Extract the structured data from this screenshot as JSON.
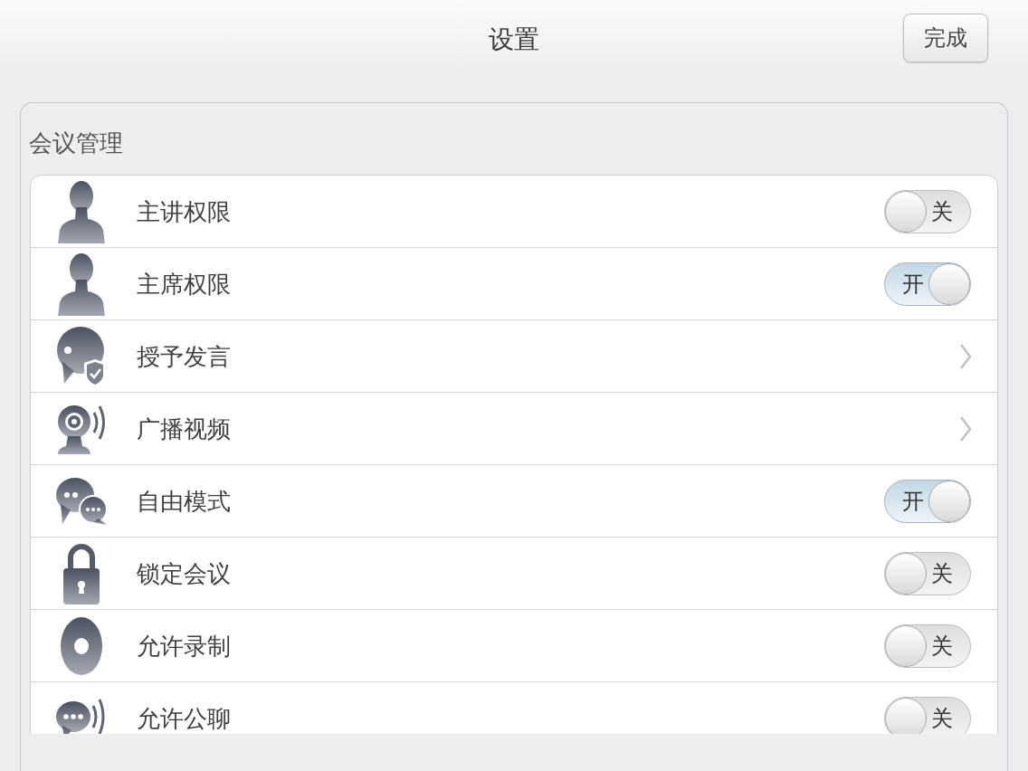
{
  "header": {
    "title": "设置",
    "done_button": "完成"
  },
  "section": {
    "title": "会议管理",
    "rows": [
      {
        "kind": "toggle",
        "label": "主讲权限",
        "on": false,
        "switch_text": "关"
      },
      {
        "kind": "toggle",
        "label": "主席权限",
        "on": true,
        "switch_text": "开"
      },
      {
        "kind": "link",
        "label": "授予发言"
      },
      {
        "kind": "link",
        "label": "广播视频"
      },
      {
        "kind": "toggle",
        "label": "自由模式",
        "on": true,
        "switch_text": "开"
      },
      {
        "kind": "toggle",
        "label": "锁定会议",
        "on": false,
        "switch_text": "关"
      },
      {
        "kind": "toggle",
        "label": "允许录制",
        "on": false,
        "switch_text": "关"
      },
      {
        "kind": "toggle",
        "label": "允许公聊",
        "on": false,
        "switch_text": "关"
      }
    ]
  }
}
